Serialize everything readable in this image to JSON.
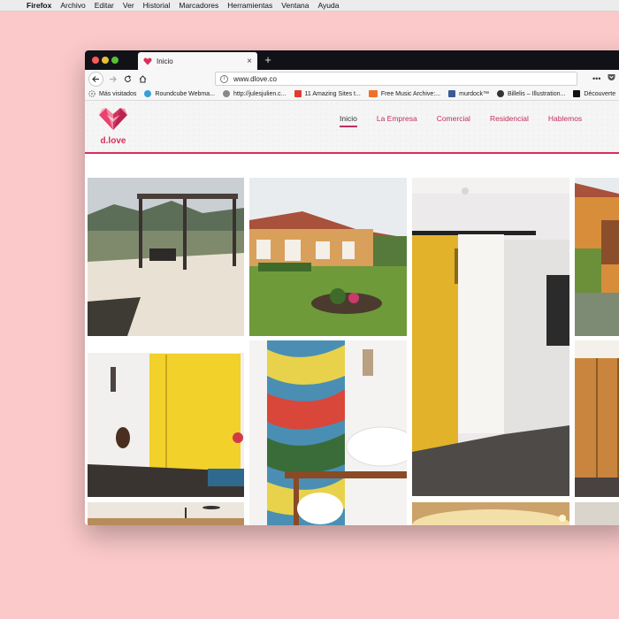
{
  "menubar": {
    "apple_icon": "apple-icon",
    "items": [
      "Firefox",
      "Archivo",
      "Editar",
      "Ver",
      "Historial",
      "Marcadores",
      "Herramientas",
      "Ventana",
      "Ayuda"
    ]
  },
  "browser": {
    "tab": {
      "title": "Inicio",
      "close": "×"
    },
    "new_tab": "+",
    "url": "www.dlove.co",
    "bookmarks": [
      {
        "label": "Más visitados",
        "icon": "gear-icon",
        "color": "#888888"
      },
      {
        "label": "Roundcube Webma...",
        "icon": "roundcube-icon",
        "color": "#37a0d8"
      },
      {
        "label": "http://julesjulien.c...",
        "icon": "globe-icon",
        "color": "#888888"
      },
      {
        "label": "11 Amazing Sites t...",
        "icon": "bookmark-icon",
        "color": "#e23a2d"
      },
      {
        "label": "Free Music Archive:...",
        "icon": "fma-icon",
        "color": "#f0702a"
      },
      {
        "label": "murdock™",
        "icon": "facebook-icon",
        "color": "#3b5998"
      },
      {
        "label": "Billelis – Illustration...",
        "icon": "billelis-icon",
        "color": "#333333"
      },
      {
        "label": "Découverte",
        "icon": "be-icon",
        "color": "#111111"
      }
    ]
  },
  "site": {
    "logo_text": "d.love",
    "brand_color": "#d6305d",
    "nav": [
      {
        "label": "Inicio",
        "active": true
      },
      {
        "label": "La Empresa",
        "active": false
      },
      {
        "label": "Comercial",
        "active": false
      },
      {
        "label": "Residencial",
        "active": false
      },
      {
        "label": "Hablemos",
        "active": false
      }
    ]
  },
  "gallery": {
    "photos": [
      "terrace-pergola-photo",
      "house-garden-photo",
      "yellow-sliding-door-photo",
      "house-exterior-photo",
      "yellow-wall-room-photo",
      "tiled-bathroom-photo",
      "wood-closet-photo",
      "interior-partial-photo",
      "ceiling-light-photo"
    ]
  }
}
